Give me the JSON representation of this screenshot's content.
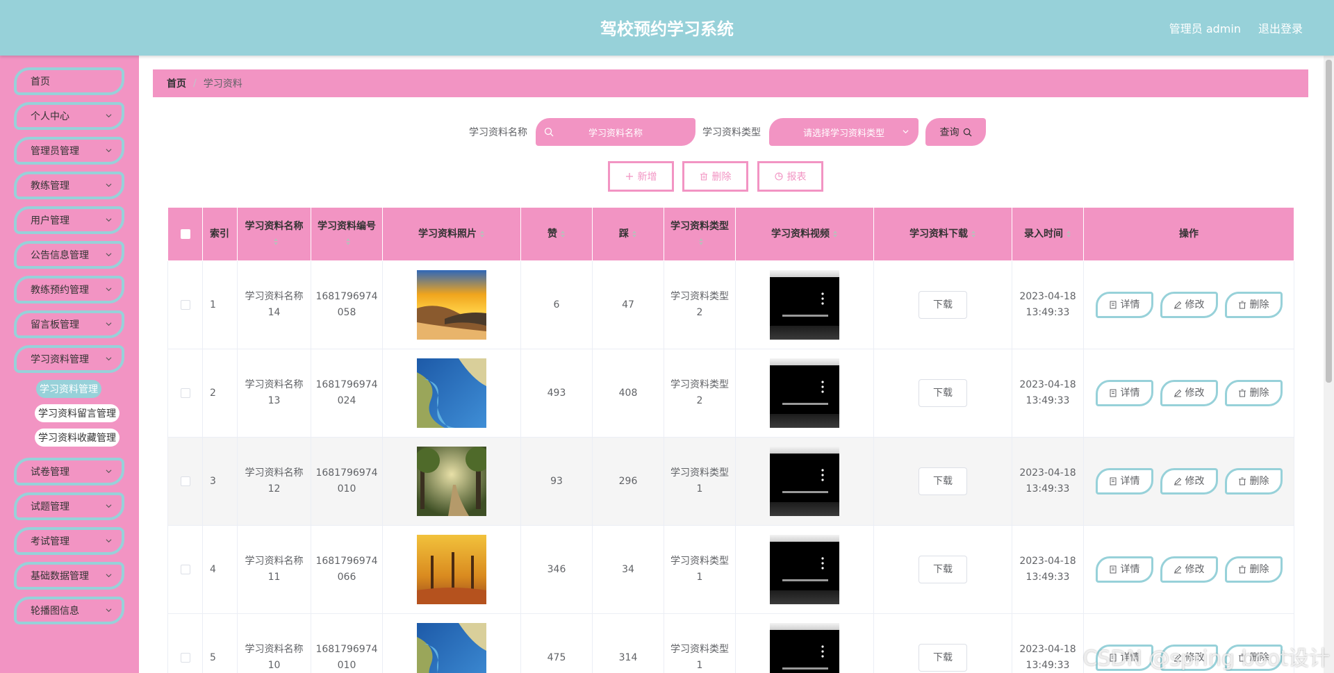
{
  "app": {
    "title": "驾校预约学习系统",
    "user_label": "管理员 admin",
    "logout_label": "退出登录"
  },
  "sidebar": {
    "items": [
      {
        "label": "首页",
        "has_arrow": false
      },
      {
        "label": "个人中心",
        "has_arrow": true
      },
      {
        "label": "管理员管理",
        "has_arrow": true
      },
      {
        "label": "教练管理",
        "has_arrow": true
      },
      {
        "label": "用户管理",
        "has_arrow": true
      },
      {
        "label": "公告信息管理",
        "has_arrow": true
      },
      {
        "label": "教练预约管理",
        "has_arrow": true
      },
      {
        "label": "留言板管理",
        "has_arrow": true
      },
      {
        "label": "学习资料管理",
        "has_arrow": true
      },
      {
        "label": "试卷管理",
        "has_arrow": true
      },
      {
        "label": "试题管理",
        "has_arrow": true
      },
      {
        "label": "考试管理",
        "has_arrow": true
      },
      {
        "label": "基础数据管理",
        "has_arrow": true
      },
      {
        "label": "轮播图信息",
        "has_arrow": true
      }
    ],
    "submenu": [
      {
        "label": "学习资料管理",
        "active": true
      },
      {
        "label": "学习资料留言管理",
        "active": false
      },
      {
        "label": "学习资料收藏管理",
        "active": false
      }
    ]
  },
  "breadcrumb": {
    "home": "首页",
    "separator": "/",
    "current": "学习资料"
  },
  "search": {
    "name_label": "学习资料名称",
    "name_placeholder": "学习资料名称",
    "type_label": "学习资料类型",
    "type_placeholder": "请选择学习资料类型",
    "query_label": "查询"
  },
  "actions": {
    "add_label": "新增",
    "delete_label": "删除",
    "report_label": "报表"
  },
  "table": {
    "headers": {
      "index": "索引",
      "name": "学习资料名称",
      "code": "学习资料编号",
      "photo": "学习资料照片",
      "like": "赞",
      "dislike": "踩",
      "type": "学习资料类型",
      "video": "学习资料视频",
      "download": "学习资料下载",
      "time": "录入时间",
      "ops": "操作"
    },
    "download_label": "下载",
    "detail_label": "详情",
    "edit_label": "修改",
    "remove_label": "删除",
    "rows": [
      {
        "index": "1",
        "name": "学习资料名称14",
        "code": "1681796974058",
        "like": "6",
        "dislike": "47",
        "type": "学习资料类型2",
        "date": "2023-04-18",
        "time": "13:49:33",
        "photo": "sunset-beach"
      },
      {
        "index": "2",
        "name": "学习资料名称13",
        "code": "1681796974024",
        "like": "493",
        "dislike": "408",
        "type": "学习资料类型2",
        "date": "2023-04-18",
        "time": "13:49:33",
        "photo": "river-aerial"
      },
      {
        "index": "3",
        "name": "学习资料名称12",
        "code": "1681796974010",
        "like": "93",
        "dislike": "296",
        "type": "学习资料类型1",
        "date": "2023-04-18",
        "time": "13:49:33",
        "photo": "forest-path"
      },
      {
        "index": "4",
        "name": "学习资料名称11",
        "code": "1681796974066",
        "like": "346",
        "dislike": "34",
        "type": "学习资料类型1",
        "date": "2023-04-18",
        "time": "13:49:33",
        "photo": "autumn-trees"
      },
      {
        "index": "5",
        "name": "学习资料名称10",
        "code": "1681796974010",
        "like": "475",
        "dislike": "314",
        "type": "学习资料类型1",
        "date": "2023-04-18",
        "time": "13:49:33",
        "photo": "river-aerial"
      }
    ]
  },
  "watermark": "CSDN @spring boot设计",
  "colors": {
    "header": "#97d1d9",
    "pink": "#f294c3",
    "teal": "#97d1d9"
  }
}
